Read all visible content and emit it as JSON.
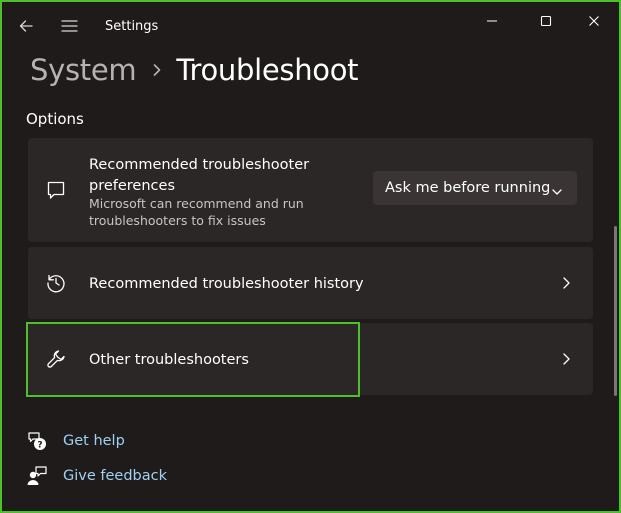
{
  "window": {
    "title": "Settings"
  },
  "breadcrumb": {
    "parent": "System",
    "current": "Troubleshoot"
  },
  "section": {
    "title": "Options"
  },
  "cards": {
    "preferences": {
      "title_line1": "Recommended troubleshooter",
      "title_line2": "preferences",
      "desc_line1": "Microsoft can recommend and run",
      "desc_line2": "troubleshooters to fix issues",
      "dropdown_value": "Ask me before running",
      "icon": "chat-icon"
    },
    "history": {
      "title": "Recommended troubleshooter history",
      "icon": "history-icon"
    },
    "other": {
      "title": "Other troubleshooters",
      "icon": "wrench-icon"
    }
  },
  "links": {
    "help": {
      "label": "Get help",
      "icon": "help-icon"
    },
    "feedback": {
      "label": "Give feedback",
      "icon": "feedback-icon"
    }
  },
  "colors": {
    "frame": "#4cc12c",
    "background": "#1f1b1a",
    "card": "#2b2726",
    "link": "#9fd1f3",
    "highlight": "#4cc12c"
  }
}
